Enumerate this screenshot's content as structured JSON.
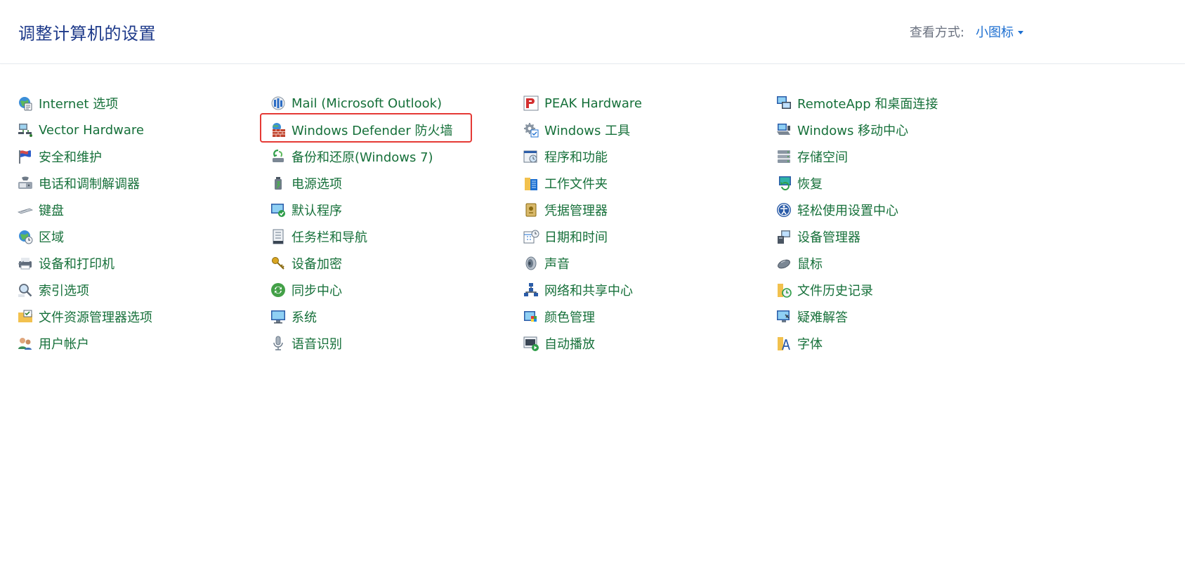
{
  "header": {
    "title": "调整计算机的设置",
    "view_by_label": "查看方式:",
    "view_by_value": "小图标"
  },
  "columns": [
    [
      {
        "label": "Internet 选项",
        "icon": "internet-options-icon"
      },
      {
        "label": "Vector Hardware",
        "icon": "network-hardware-icon"
      },
      {
        "label": "安全和维护",
        "icon": "flag-icon"
      },
      {
        "label": "电话和调制解调器",
        "icon": "phone-modem-icon"
      },
      {
        "label": "键盘",
        "icon": "keyboard-icon"
      },
      {
        "label": "区域",
        "icon": "globe-clock-icon"
      },
      {
        "label": "设备和打印机",
        "icon": "printer-icon"
      },
      {
        "label": "索引选项",
        "icon": "magnifier-icon"
      },
      {
        "label": "文件资源管理器选项",
        "icon": "folder-options-icon"
      },
      {
        "label": "用户帐户",
        "icon": "user-accounts-icon"
      }
    ],
    [
      {
        "label": "Mail (Microsoft Outlook)",
        "icon": "mail-icon"
      },
      {
        "label": "Windows Defender 防火墙",
        "icon": "firewall-icon"
      },
      {
        "label": "备份和还原(Windows 7)",
        "icon": "backup-icon"
      },
      {
        "label": "电源选项",
        "icon": "power-options-icon"
      },
      {
        "label": "默认程序",
        "icon": "default-programs-icon"
      },
      {
        "label": "任务栏和导航",
        "icon": "taskbar-icon"
      },
      {
        "label": "设备加密",
        "icon": "key-icon"
      },
      {
        "label": "同步中心",
        "icon": "sync-icon"
      },
      {
        "label": "系统",
        "icon": "monitor-icon"
      },
      {
        "label": "语音识别",
        "icon": "microphone-icon"
      }
    ],
    [
      {
        "label": "PEAK Hardware",
        "icon": "peak-icon"
      },
      {
        "label": "Windows 工具",
        "icon": "gear-icon"
      },
      {
        "label": "程序和功能",
        "icon": "programs-icon"
      },
      {
        "label": "工作文件夹",
        "icon": "work-folder-icon"
      },
      {
        "label": "凭据管理器",
        "icon": "credential-icon"
      },
      {
        "label": "日期和时间",
        "icon": "calendar-icon"
      },
      {
        "label": "声音",
        "icon": "speaker-icon"
      },
      {
        "label": "网络和共享中心",
        "icon": "network-icon"
      },
      {
        "label": "颜色管理",
        "icon": "color-icon"
      },
      {
        "label": "自动播放",
        "icon": "autoplay-icon"
      }
    ],
    [
      {
        "label": "RemoteApp 和桌面连接",
        "icon": "remote-desktop-icon"
      },
      {
        "label": "Windows 移动中心",
        "icon": "mobility-icon"
      },
      {
        "label": "存储空间",
        "icon": "storage-icon"
      },
      {
        "label": "恢复",
        "icon": "recovery-icon"
      },
      {
        "label": "轻松使用设置中心",
        "icon": "ease-of-access-icon"
      },
      {
        "label": "设备管理器",
        "icon": "device-manager-icon"
      },
      {
        "label": "鼠标",
        "icon": "mouse-icon"
      },
      {
        "label": "文件历史记录",
        "icon": "file-history-icon"
      },
      {
        "label": "疑难解答",
        "icon": "troubleshoot-icon"
      },
      {
        "label": "字体",
        "icon": "font-icon"
      }
    ]
  ],
  "colors": {
    "link": "#16703a",
    "title": "#1e3a8a",
    "accent": "#1d6fd1",
    "highlight": "#e53935"
  }
}
